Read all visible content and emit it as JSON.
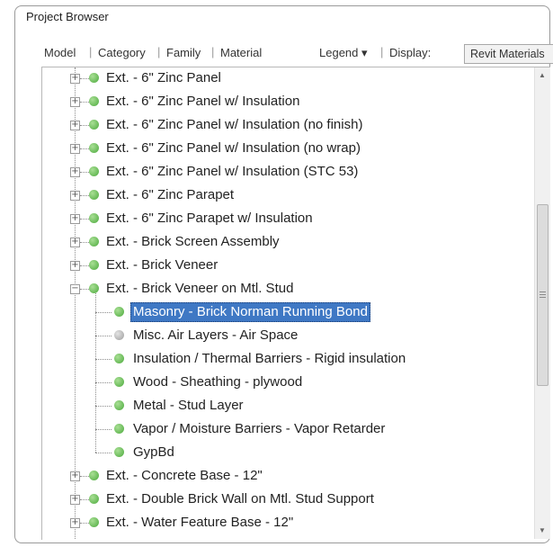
{
  "panel": {
    "title": "Project Browser"
  },
  "toolbar": {
    "links": [
      "Model",
      "Category",
      "Family",
      "Material"
    ],
    "legend_label": "Legend",
    "legend_arrow": "▾",
    "display_label": "Display:",
    "display_value": "Revit Materials",
    "display_arrow": "▼",
    "separator": "|"
  },
  "tree": {
    "expand_glyph": "+",
    "collapse_glyph": "−",
    "rows": [
      {
        "label": "Ext. - 6\" Zinc Panel",
        "level": 0,
        "state": "collapsed",
        "status": "green"
      },
      {
        "label": "Ext. - 6\" Zinc Panel w/ Insulation",
        "level": 0,
        "state": "collapsed",
        "status": "green"
      },
      {
        "label": "Ext. - 6\" Zinc Panel w/ Insulation (no finish)",
        "level": 0,
        "state": "collapsed",
        "status": "green"
      },
      {
        "label": "Ext. - 6\" Zinc Panel w/ Insulation (no wrap)",
        "level": 0,
        "state": "collapsed",
        "status": "green"
      },
      {
        "label": "Ext. - 6\" Zinc Panel w/ Insulation (STC 53)",
        "level": 0,
        "state": "collapsed",
        "status": "green"
      },
      {
        "label": "Ext. - 6\" Zinc Parapet",
        "level": 0,
        "state": "collapsed",
        "status": "green"
      },
      {
        "label": "Ext. - 6\" Zinc Parapet w/ Insulation",
        "level": 0,
        "state": "collapsed",
        "status": "green"
      },
      {
        "label": "Ext. - Brick Screen Assembly",
        "level": 0,
        "state": "collapsed",
        "status": "green"
      },
      {
        "label": "Ext. - Brick Veneer",
        "level": 0,
        "state": "collapsed",
        "status": "green"
      },
      {
        "label": "Ext. - Brick Veneer on Mtl. Stud",
        "level": 0,
        "state": "expanded",
        "status": "green"
      },
      {
        "label": "Masonry - Brick Norman Running Bond",
        "level": 1,
        "status": "green",
        "selected": true
      },
      {
        "label": "Misc. Air Layers - Air Space",
        "level": 1,
        "status": "gray"
      },
      {
        "label": "Insulation / Thermal Barriers - Rigid insulation",
        "level": 1,
        "status": "green"
      },
      {
        "label": "Wood - Sheathing - plywood",
        "level": 1,
        "status": "green"
      },
      {
        "label": "Metal - Stud Layer",
        "level": 1,
        "status": "green"
      },
      {
        "label": "Vapor / Moisture Barriers - Vapor Retarder",
        "level": 1,
        "status": "green"
      },
      {
        "label": "GypBd",
        "level": 1,
        "status": "green"
      },
      {
        "label": "Ext. - Concrete Base - 12\"",
        "level": 0,
        "state": "collapsed",
        "status": "green"
      },
      {
        "label": "Ext. - Double Brick Wall on Mtl. Stud Support",
        "level": 0,
        "state": "collapsed",
        "status": "green"
      },
      {
        "label": "Ext. - Water Feature  Base - 12\"",
        "level": 0,
        "state": "collapsed",
        "status": "green"
      }
    ]
  },
  "scrollbar": {
    "up_arrow": "▲",
    "down_arrow": "▼"
  },
  "colors": {
    "status_green": "#4caa3d",
    "status_gray": "#9c9c9c",
    "selection": "#3f78c4"
  }
}
